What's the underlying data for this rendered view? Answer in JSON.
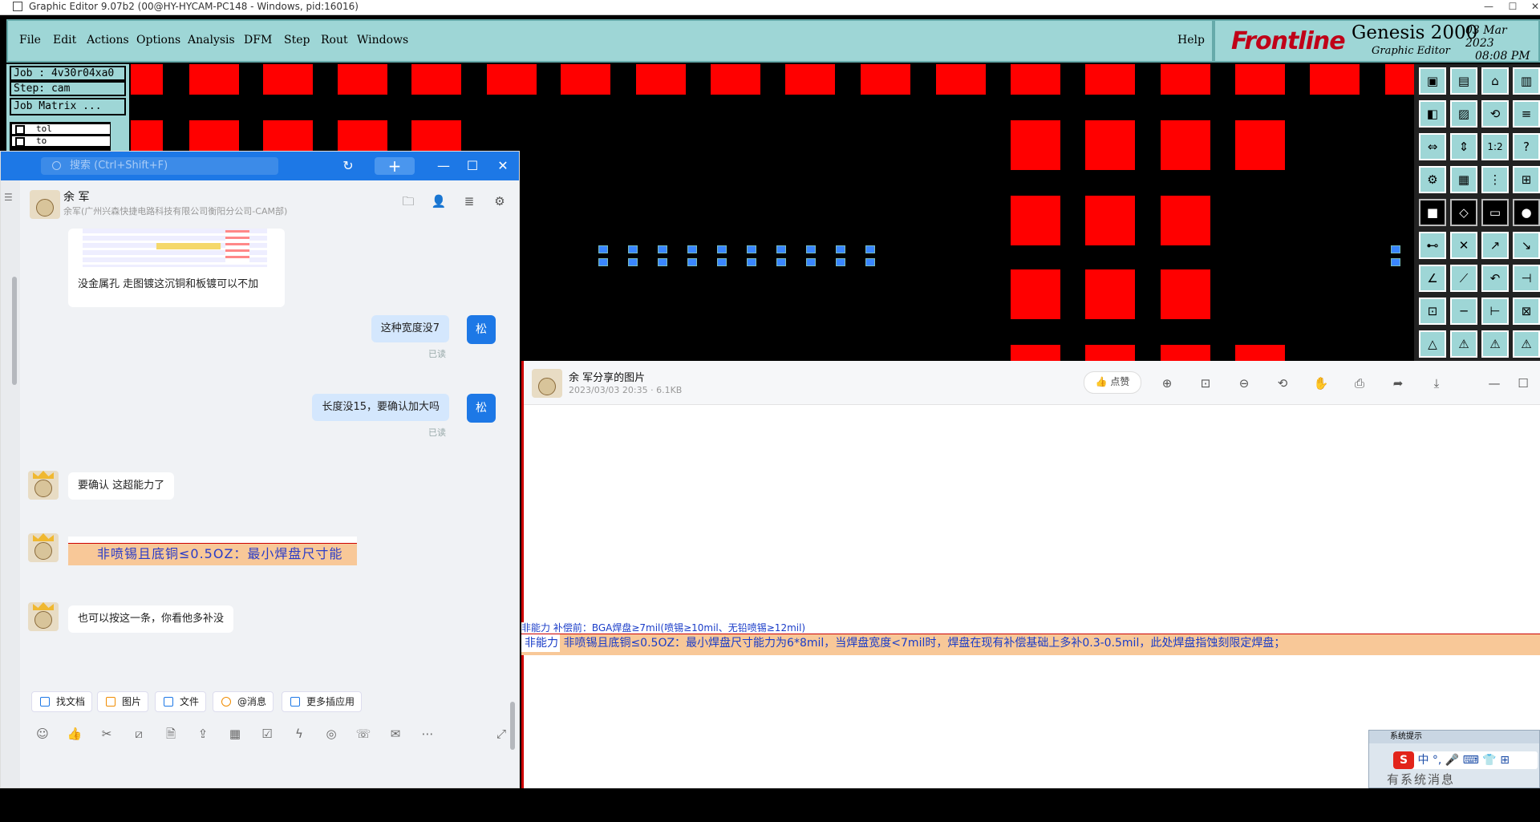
{
  "titlebar": {
    "title": "Graphic Editor 9.07b2 (00@HY-HYCAM-PC148 - Windows, pid:16016)",
    "minimize": "—",
    "maximize": "☐",
    "close": "✕"
  },
  "menu": {
    "items": [
      "File",
      "Edit",
      "Actions",
      "Options",
      "Analysis",
      "DFM",
      "Step",
      "Rout",
      "Windows"
    ],
    "help": "Help"
  },
  "brand": {
    "logo": "Frontline",
    "product": "Genesis 2000",
    "subtitle": "Graphic Editor",
    "date": "03 Mar 2023",
    "time": "08:08 PM"
  },
  "job_panel": {
    "job": "Job : 4v30r04xa0",
    "step": "Step: cam",
    "job_matrix": "Job Matrix ...",
    "layers": [
      "tol",
      "to"
    ]
  },
  "colors": {
    "pad_red": "#ff0000",
    "pad_blue": "#3a86ff",
    "menu_bg": "#9ed6d6",
    "chat_blue": "#1d78e6"
  },
  "chat": {
    "search_placeholder": "搜索 (Ctrl+Shift+F)",
    "contact_name": "余 军",
    "contact_org": "余军(广州兴森快捷电路科技有限公司衡阳分公司-CAM部)",
    "messages": [
      {
        "from": "other",
        "text": "没金属孔 走图镀这沉铜和板镀可以不加"
      },
      {
        "from": "me",
        "avatar": "松",
        "text": "这种宽度没7",
        "status": "已读"
      },
      {
        "from": "me",
        "avatar": "松",
        "text": "长度没15，要确认加大吗",
        "status": "已读"
      },
      {
        "from": "other",
        "text": "要确认 这超能力了"
      },
      {
        "from": "other",
        "image_text": "非喷锡且底铜≤0.5OZ：最小焊盘尺寸能"
      },
      {
        "from": "other",
        "text": "也可以按这一条，你看他多补没"
      }
    ],
    "chips": [
      "找文档",
      "图片",
      "文件",
      "@消息",
      "更多插应用"
    ],
    "bottom_icons": [
      "emoji-icon",
      "thumb-icon",
      "scissors-icon",
      "slash-icon",
      "doc-icon",
      "upload-icon",
      "calendar-icon",
      "check-icon",
      "bolt-icon",
      "screen-icon",
      "phone-icon",
      "mail-icon",
      "more-icon",
      "expand-icon"
    ]
  },
  "viewer": {
    "title": "余 军分享的图片",
    "meta": "2023/03/03 20:35 · 6.1KB",
    "like": "点赞"
  },
  "spec_strip": {
    "line1": "非能力  补偿前：BGA焊盘≥7mil(喷锡≥10mil、无铅喷锡≥12mil)",
    "line2_label": "非能力",
    "line2": "非喷锡且底铜≤0.5OZ：最小焊盘尺寸能力为6*8mil，当焊盘宽度<7mil时，焊盘在现有补偿基础上多补0.3-0.5mil，此处焊盘指蚀刻限定焊盘；"
  },
  "systip": {
    "header": "系统提示",
    "ime": "中 °, 🎤 ⌨ 👕 ⊞",
    "message": "有系统消息"
  }
}
